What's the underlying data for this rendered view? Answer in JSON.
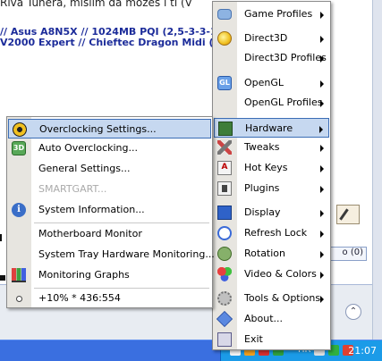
{
  "background": {
    "line0": "Riva Tunera, mislim da možeš i ti (V",
    "line1": "// Asus A8N5X // 1024MB PQI (2,5-3-3-1",
    "line2": "V2000 Expert // Chieftec Dragon Midi (Blu",
    "reply_count": "o (0)",
    "scroll_up_glyph": "⌃"
  },
  "right_menu": {
    "items": [
      {
        "label": "Game Profiles",
        "icon": "gamepad-icon",
        "submenu": true
      },
      {
        "label": "Direct3D",
        "icon": "direct3d-icon",
        "submenu": true
      },
      {
        "label": "Direct3D Profiles",
        "icon": "",
        "submenu": true
      },
      {
        "label": "OpenGL",
        "icon": "opengl-icon",
        "icon_text": "GL",
        "submenu": true
      },
      {
        "label": "OpenGL Profiles",
        "icon": "",
        "submenu": true
      },
      {
        "label": "Hardware",
        "icon": "hardware-chip-icon",
        "submenu": true,
        "highlighted": true
      },
      {
        "label": "Tweaks",
        "icon": "tweaks-tools-icon",
        "submenu": true
      },
      {
        "label": "Hot Keys",
        "icon": "hotkeys-icon",
        "icon_text": "A",
        "submenu": true
      },
      {
        "label": "Plugins",
        "icon": "plugins-icon",
        "submenu": true
      },
      {
        "label": "Display",
        "icon": "display-icon",
        "submenu": true
      },
      {
        "label": "Refresh Lock",
        "icon": "refresh-lock-icon",
        "submenu": true
      },
      {
        "label": "Rotation",
        "icon": "rotation-icon",
        "submenu": true
      },
      {
        "label": "Video & Colors",
        "icon": "video-colors-icon",
        "submenu": true
      },
      {
        "label": "Tools & Options",
        "icon": "tools-gear-icon",
        "submenu": true
      },
      {
        "label": "About...",
        "icon": "about-icon",
        "submenu": false
      },
      {
        "label": "Exit",
        "icon": "exit-icon",
        "submenu": false
      }
    ]
  },
  "left_menu": {
    "items": [
      {
        "label": "Overclocking Settings...",
        "icon": "overclocking-icon",
        "highlighted": true
      },
      {
        "label": "Auto Overclocking...",
        "icon": "auto-overclocking-icon",
        "icon_text": "3D"
      },
      {
        "label": "General Settings...",
        "icon": ""
      },
      {
        "label": "SMARTGART...",
        "icon": "",
        "disabled": true
      },
      {
        "label": "System Information...",
        "icon": "info-icon",
        "icon_text": "i"
      },
      {
        "label": "Motherboard Monitor",
        "icon": ""
      },
      {
        "label": "System Tray Hardware Monitoring...",
        "icon": ""
      },
      {
        "label": "Monitoring Graphs",
        "icon": "graphs-icon"
      },
      {
        "label": "+10% * 436:554",
        "icon": "radio-dot-icon"
      }
    ]
  },
  "taskbar": {
    "language": "HR",
    "clock": "21:07"
  },
  "colors": {
    "highlight_bg": "#c6d8f0",
    "highlight_border": "#3b6db5",
    "taskbar": "#3a6fe0",
    "tray": "#1b9be8"
  }
}
